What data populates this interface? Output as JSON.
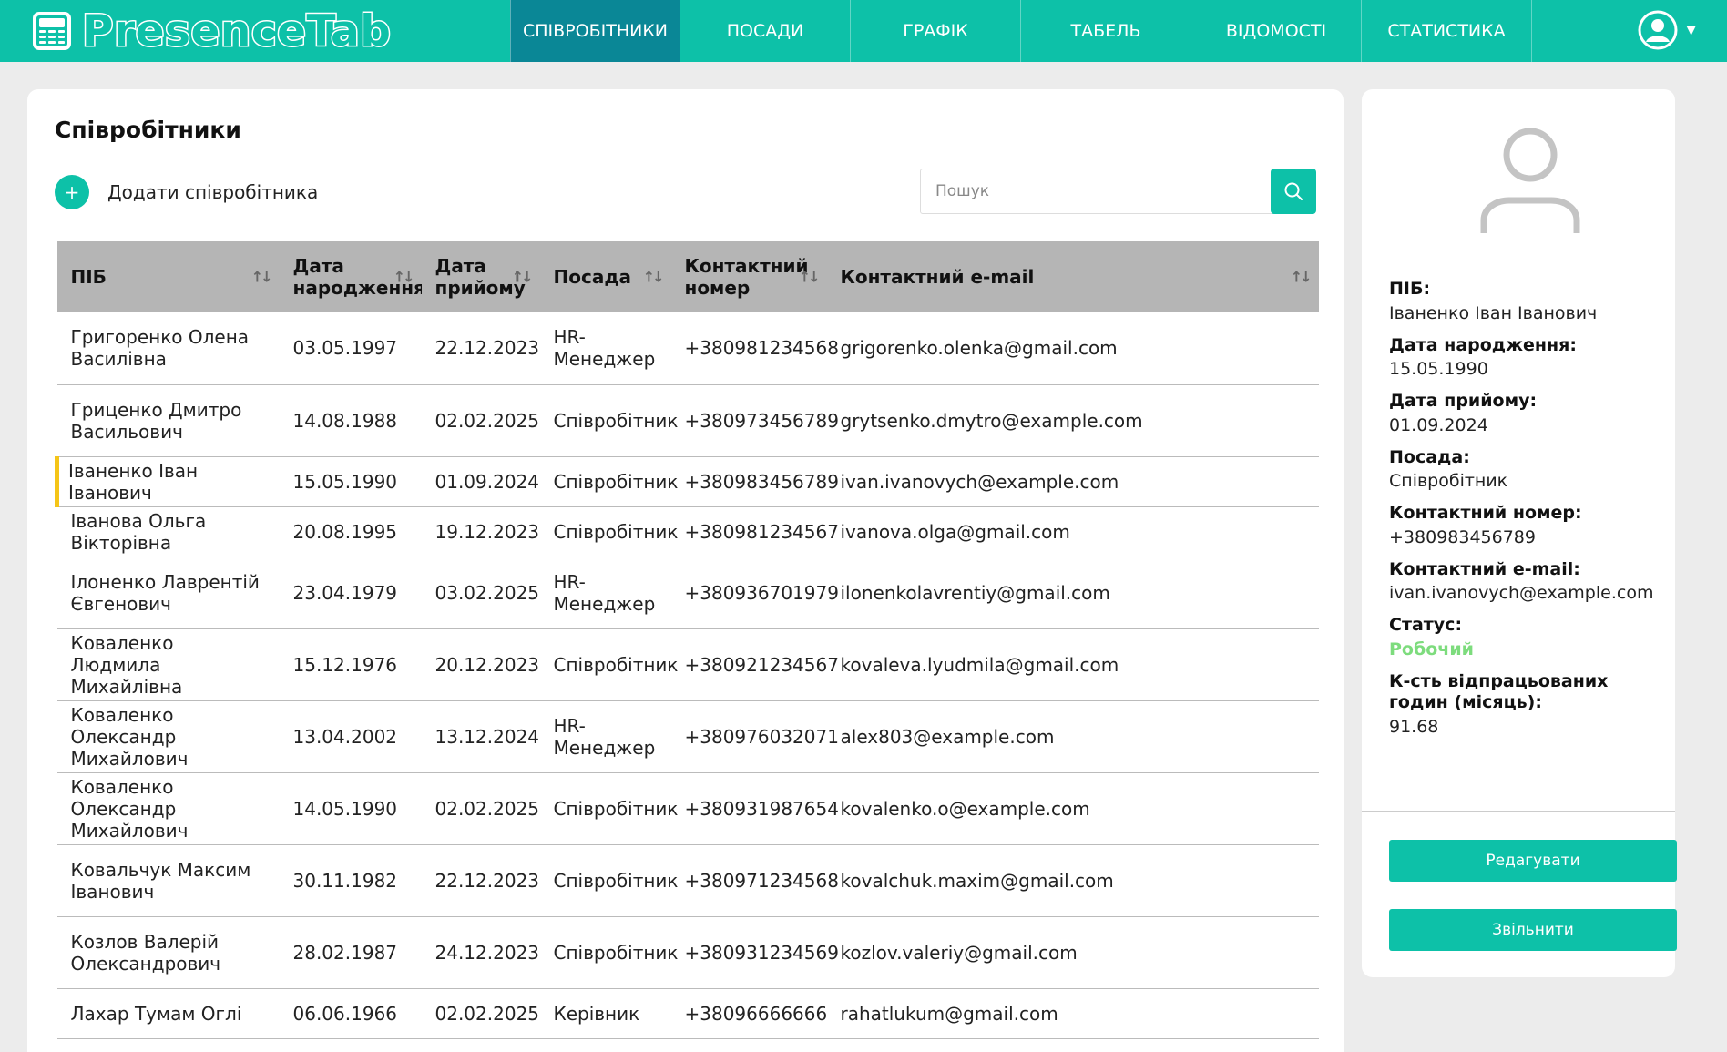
{
  "app": {
    "logo_text": "PresenceTab"
  },
  "nav": [
    {
      "label": "Співробітники",
      "active": true
    },
    {
      "label": "Посади"
    },
    {
      "label": "Графік"
    },
    {
      "label": "Табель"
    },
    {
      "label": "Відомості"
    },
    {
      "label": "Статистика"
    }
  ],
  "page": {
    "title": "Співробітники",
    "add_label": "Додати співробітника",
    "search_placeholder": "Пошук"
  },
  "table": {
    "columns": [
      "ПІБ",
      "Дата народження",
      "Дата прийому",
      "Посада",
      "Контактний номер",
      "Контактний e-mail"
    ],
    "rows": [
      [
        "Григоренко Олена Василівна",
        "03.05.1997",
        "22.12.2023",
        "HR-Менеджер",
        "+380981234568",
        "grigorenko.olenka@gmail.com"
      ],
      [
        "Гриценко Дмитро Васильович",
        "14.08.1988",
        "02.02.2025",
        "Співробітник",
        "+380973456789",
        "grytsenko.dmytro@example.com"
      ],
      [
        "Іваненко Іван Іванович",
        "15.05.1990",
        "01.09.2024",
        "Співробітник",
        "+380983456789",
        "ivan.ivanovych@example.com"
      ],
      [
        "Іванова Ольга Вікторівна",
        "20.08.1995",
        "19.12.2023",
        "Співробітник",
        "+380981234567",
        "ivanova.olga@gmail.com"
      ],
      [
        "Ілоненко Лаврентій Євгенович",
        "23.04.1979",
        "03.02.2025",
        "HR-Менеджер",
        "+380936701979",
        "ilonenkolavrentiy@gmail.com"
      ],
      [
        "Коваленко Людмила Михайлівна",
        "15.12.1976",
        "20.12.2023",
        "Співробітник",
        "+380921234567",
        "kovaleva.lyudmila@gmail.com"
      ],
      [
        "Коваленко Олександр Михайлович",
        "13.04.2002",
        "13.12.2024",
        "HR-Менеджер",
        "+380976032071",
        "alex803@example.com"
      ],
      [
        "Коваленко Олександр Михайлович",
        "14.05.1990",
        "02.02.2025",
        "Співробітник",
        "+380931987654",
        "kovalenko.o@example.com"
      ],
      [
        "Ковальчук Максим Іванович",
        "30.11.1982",
        "22.12.2023",
        "Співробітник",
        "+380971234568",
        "kovalchuk.maxim@gmail.com"
      ],
      [
        "Козлов Валерій Олександрович",
        "28.02.1987",
        "24.12.2023",
        "Співробітник",
        "+380931234569",
        "kozlov.valeriy@gmail.com"
      ],
      [
        "Лахар Тумам Оглі",
        "06.06.1966",
        "02.02.2025",
        "Керівник",
        "+38096666666",
        "rahatlukum@gmail.com"
      ]
    ],
    "selected_row": 2
  },
  "detail": {
    "fields": [
      {
        "label": "ПІБ:",
        "value": "Іваненко Іван Іванович"
      },
      {
        "label": "Дата народження:",
        "value": "15.05.1990"
      },
      {
        "label": "Дата прийому:",
        "value": "01.09.2024"
      },
      {
        "label": "Посада:",
        "value": "Співробітник"
      },
      {
        "label": "Контактний номер:",
        "value": "+380983456789"
      },
      {
        "label": "Контактний e-mail:",
        "value": "ivan.ivanovych@example.com"
      },
      {
        "label": "Статус:",
        "value": "Робочий"
      },
      {
        "label": "К-сть відпрацьованих годин (місяць):",
        "value": "91.68"
      }
    ],
    "edit_label": "Редагувати",
    "fire_label": "Звільнити"
  },
  "colors": {
    "accent": "#0dc1a8",
    "nav_active": "#0a8796",
    "header_bg": "#b5b5b5",
    "selected_marker": "#f5c518",
    "status_ok": "#7ddc7d"
  },
  "icons": {
    "logo": "calendar-grid-icon",
    "user": "user-circle-icon",
    "search": "search-icon",
    "add": "plus-icon",
    "sort": "sort-arrows-icon",
    "avatar": "person-icon"
  }
}
